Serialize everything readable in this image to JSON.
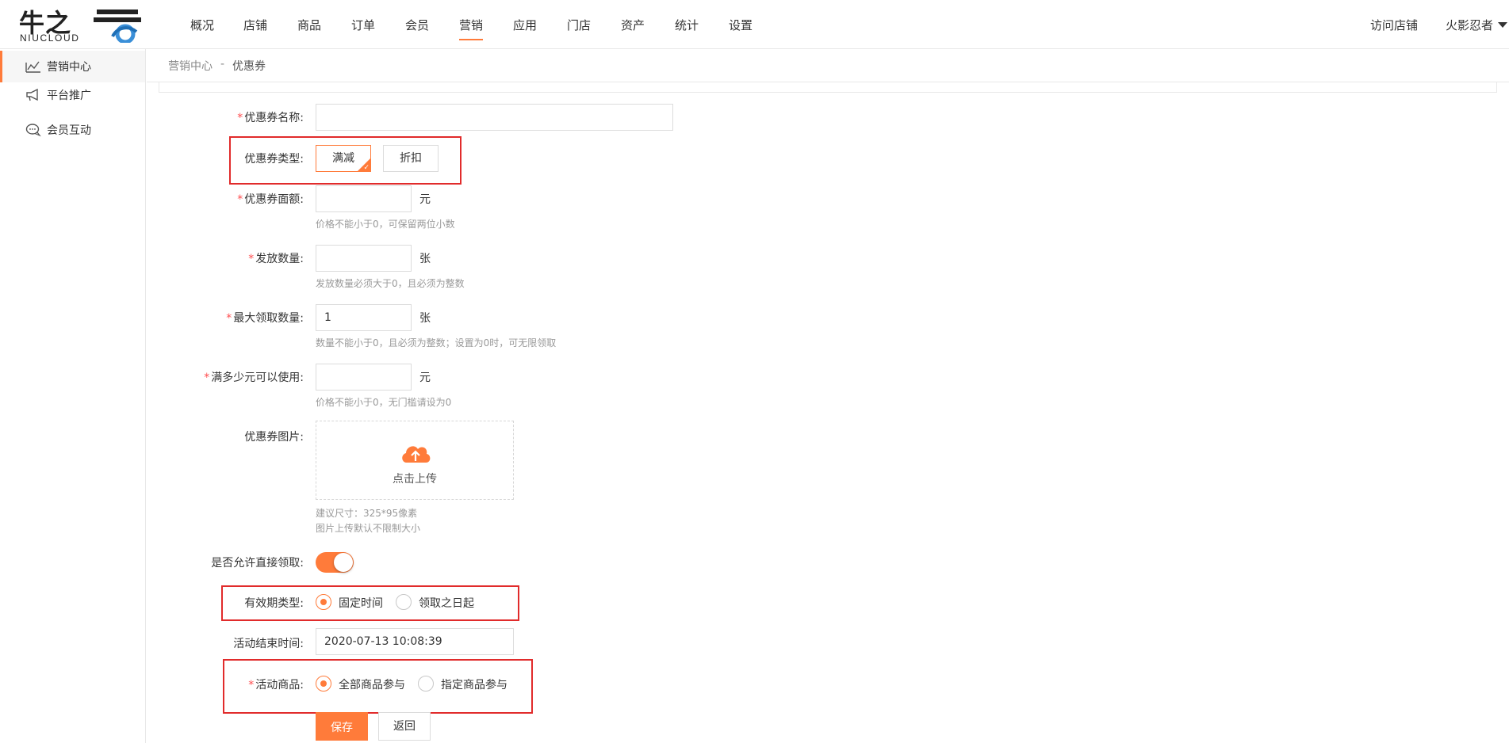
{
  "logo": {
    "cn": "牛之",
    "en": "NIUCLOUD"
  },
  "nav": {
    "items": [
      "概况",
      "店铺",
      "商品",
      "订单",
      "会员",
      "营销",
      "应用",
      "门店",
      "资产",
      "统计",
      "设置"
    ],
    "active": "营销",
    "visit_store": "访问店铺",
    "user": "火影忍者"
  },
  "sidebar": {
    "items": [
      {
        "label": "营销中心",
        "icon": "chart-line-icon",
        "active": true
      },
      {
        "label": "平台推广",
        "icon": "megaphone-icon",
        "active": false
      },
      {
        "label": "会员互动",
        "icon": "chat-bubbles-icon",
        "active": false
      }
    ]
  },
  "breadcrumb": {
    "parent": "营销中心",
    "sep": "-",
    "current": "优惠券"
  },
  "form": {
    "name": {
      "label": "优惠券名称:",
      "value": ""
    },
    "type": {
      "label": "优惠券类型:",
      "options": [
        "满减",
        "折扣"
      ],
      "selected": "满减"
    },
    "amount": {
      "label": "优惠券面额:",
      "value": "",
      "unit": "元",
      "hint": "价格不能小于0，可保留两位小数"
    },
    "quantity": {
      "label": "发放数量:",
      "value": "",
      "unit": "张",
      "hint": "发放数量必须大于0，且必须为整数"
    },
    "max_claim": {
      "label": "最大领取数量:",
      "value": "1",
      "unit": "张",
      "hint": "数量不能小于0，且必须为整数；设置为0时，可无限领取"
    },
    "threshold": {
      "label": "满多少元可以使用:",
      "value": "",
      "unit": "元",
      "hint": "价格不能小于0，无门槛请设为0"
    },
    "image": {
      "label": "优惠券图片:",
      "upload_label": "点击上传",
      "hint1": "建议尺寸：325*95像素",
      "hint2": "图片上传默认不限制大小"
    },
    "direct_claim": {
      "label": "是否允许直接领取:",
      "enabled": true
    },
    "validity": {
      "label": "有效期类型:",
      "options": [
        "固定时间",
        "领取之日起"
      ],
      "selected": "固定时间"
    },
    "end_time": {
      "label": "活动结束时间:",
      "value": "2020-07-13 10:08:39"
    },
    "goods": {
      "label": "活动商品:",
      "options": [
        "全部商品参与",
        "指定商品参与"
      ],
      "selected": "全部商品参与"
    },
    "save_label": "保存",
    "back_label": "返回"
  },
  "colors": {
    "accent": "#ff7b3a",
    "highlight": "#e12b2b",
    "required": "#ff4d4f"
  }
}
